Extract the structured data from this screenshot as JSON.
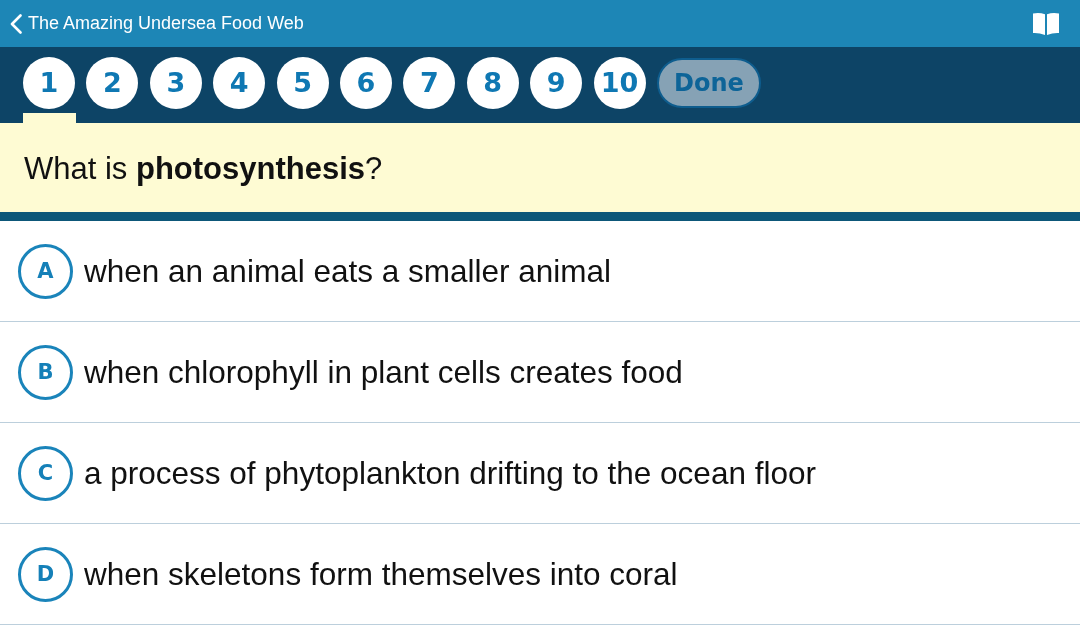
{
  "nav_bar": {
    "back_title": "The Amazing Undersea Food Web"
  },
  "question_tabs": [
    {
      "label": "1",
      "selected": true
    },
    {
      "label": "2",
      "selected": false
    },
    {
      "label": "3",
      "selected": false
    },
    {
      "label": "4",
      "selected": false
    },
    {
      "label": "5",
      "selected": false
    },
    {
      "label": "6",
      "selected": false
    },
    {
      "label": "7",
      "selected": false
    },
    {
      "label": "8",
      "selected": false
    },
    {
      "label": "9",
      "selected": false
    },
    {
      "label": "10",
      "selected": false
    }
  ],
  "done_button": {
    "label": "Done",
    "disabled": true
  },
  "question": {
    "text": "What is **photosynthesis**?"
  },
  "answers": [
    {
      "letter": "A",
      "text": "when an animal eats a smaller animal",
      "selected": false
    },
    {
      "letter": "B",
      "text": "when chlorophyll in plant cells creates food",
      "selected": false
    },
    {
      "letter": "C",
      "text": "a process of phytoplankton drifting to the ocean floor",
      "selected": false
    },
    {
      "letter": "D",
      "text": "when skeletons form themselves into coral",
      "selected": false
    }
  ]
}
